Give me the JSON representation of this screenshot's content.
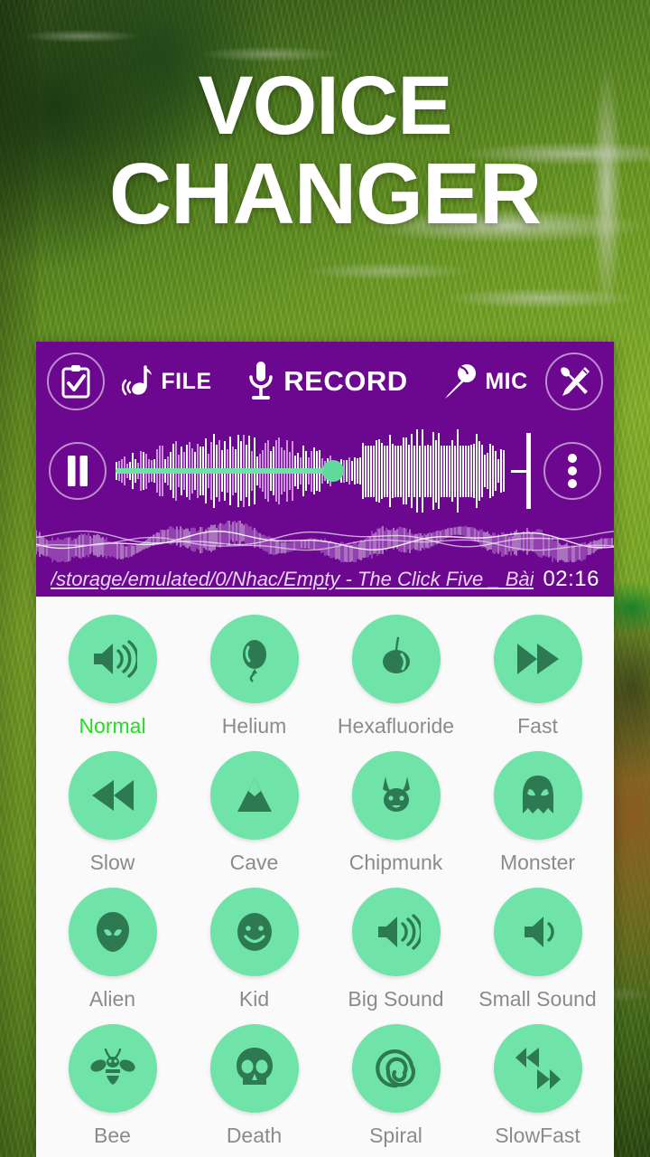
{
  "app": {
    "title_line1": "VOICE",
    "title_line2": "CHANGER",
    "accent_purple": "#6B088F",
    "accent_green": "#6FE3A8",
    "icon_green": "#2D7A52",
    "selected_label_green": "#22DD22"
  },
  "header": {
    "notes_button": {
      "icon": "clipboard-check-icon"
    },
    "file": {
      "label": "FILE",
      "icon": "music-note-icon"
    },
    "record": {
      "label": "RECORD",
      "icon": "microphone-icon"
    },
    "mic": {
      "label": "MIC",
      "icon": "handheld-mic-icon"
    },
    "settings_button": {
      "icon": "wrench-pencil-icon"
    }
  },
  "player": {
    "transport_icon": "pause-icon",
    "overflow_icon": "three-dots-vertical-icon",
    "progress_percent": 52,
    "file_path": "/storage/emulated/0/Nhac/Empty - The Click Five _ Bài..",
    "time": "02:16"
  },
  "effects": {
    "selected": "Normal",
    "items": [
      {
        "label": "Normal",
        "icon": "speaker-waves-icon"
      },
      {
        "label": "Helium",
        "icon": "balloon-icon"
      },
      {
        "label": "Hexafluoride",
        "icon": "heavy-balloon-icon"
      },
      {
        "label": "Fast",
        "icon": "fast-forward-icon"
      },
      {
        "label": "Slow",
        "icon": "rewind-icon"
      },
      {
        "label": "Cave",
        "icon": "mountain-icon"
      },
      {
        "label": "Chipmunk",
        "icon": "chipmunk-icon"
      },
      {
        "label": "Monster",
        "icon": "monster-ghost-icon"
      },
      {
        "label": "Alien",
        "icon": "alien-head-icon"
      },
      {
        "label": "Kid",
        "icon": "smiley-face-icon"
      },
      {
        "label": "Big Sound",
        "icon": "speaker-loud-icon"
      },
      {
        "label": "Small Sound",
        "icon": "speaker-quiet-icon"
      },
      {
        "label": "Bee",
        "icon": "bee-icon"
      },
      {
        "label": "Death",
        "icon": "skull-icon"
      },
      {
        "label": "Spiral",
        "icon": "spiral-icon"
      },
      {
        "label": "SlowFast",
        "icon": "rewind-fastforward-icon"
      }
    ]
  }
}
